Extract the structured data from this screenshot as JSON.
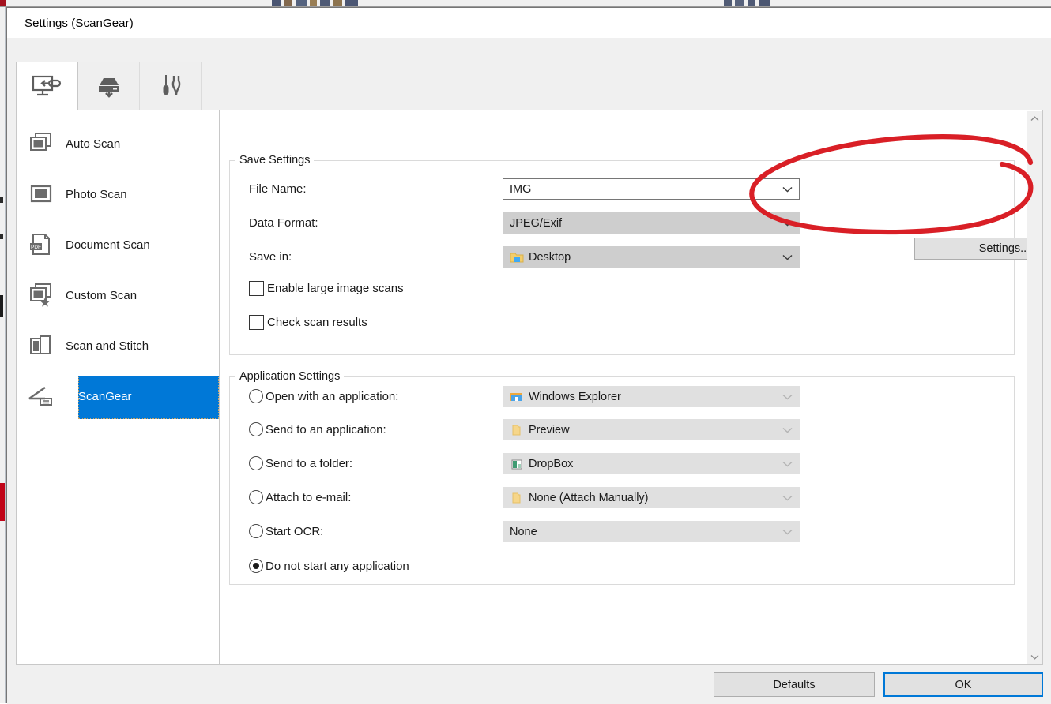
{
  "window": {
    "title": "Settings (ScanGear)"
  },
  "tabs": [
    {
      "name": "scan-from-computer",
      "icon": "monitor-arrow-icon",
      "active": true
    },
    {
      "name": "scan-from-device",
      "icon": "scanner-download-icon",
      "active": false
    },
    {
      "name": "general-settings",
      "icon": "tools-icon",
      "active": false
    }
  ],
  "sidebar": {
    "items": [
      {
        "label": "Auto Scan",
        "icon": "auto-scan-icon",
        "selected": false
      },
      {
        "label": "Photo Scan",
        "icon": "photo-scan-icon",
        "selected": false
      },
      {
        "label": "Document Scan",
        "icon": "pdf-document-icon",
        "selected": false
      },
      {
        "label": "Custom Scan",
        "icon": "custom-scan-star-icon",
        "selected": false
      },
      {
        "label": "Scan and Stitch",
        "icon": "scan-stitch-icon",
        "selected": false
      },
      {
        "label": "ScanGear",
        "icon": "scangear-icon",
        "selected": true
      }
    ]
  },
  "save_settings": {
    "title": "Save Settings",
    "file_name": {
      "label": "File Name:",
      "value": "IMG",
      "state": "editable"
    },
    "data_format": {
      "label": "Data Format:",
      "value": "JPEG/Exif",
      "state": "disabled"
    },
    "save_in": {
      "label": "Save in:",
      "value": "Desktop",
      "icon": "desktop-folder-icon",
      "state": "disabled"
    },
    "settings_button": "Settings...",
    "checkboxes": [
      {
        "label": "Enable large image scans",
        "checked": false
      },
      {
        "label": "Check scan results",
        "checked": false
      }
    ]
  },
  "application_settings": {
    "title": "Application Settings",
    "options": [
      {
        "label": "Open with an application:",
        "selected": false,
        "value": "Windows Explorer",
        "icon": "explorer-folder-icon",
        "has_dropdown": true
      },
      {
        "label": "Send to an application:",
        "selected": false,
        "value": "Preview",
        "icon": "yellow-folder-icon",
        "has_dropdown": true
      },
      {
        "label": "Send to a folder:",
        "selected": false,
        "value": "DropBox",
        "icon": "dropbox-icon",
        "has_dropdown": true
      },
      {
        "label": "Attach to e-mail:",
        "selected": false,
        "value": "None (Attach Manually)",
        "icon": "yellow-folder-icon",
        "has_dropdown": true
      },
      {
        "label": "Start OCR:",
        "selected": false,
        "value": "None",
        "icon": "none",
        "has_dropdown": true
      },
      {
        "label": "Do not start any application",
        "selected": true,
        "value": null,
        "icon": "none",
        "has_dropdown": false
      }
    ]
  },
  "footer": {
    "defaults_label": "Defaults",
    "ok_label": "OK"
  },
  "scrollbar": {
    "up_icon": "chevron-up-icon",
    "down_icon": "chevron-down-icon"
  },
  "annotation": {
    "shape": "hand-drawn-red-ellipse",
    "color": "#d91f26",
    "targets": "settings-button"
  },
  "colors": {
    "accent": "#0078d7",
    "annotation_red": "#d91f26",
    "dialog_bg": "#f0f0f0",
    "field_disabled": "#cecece"
  }
}
